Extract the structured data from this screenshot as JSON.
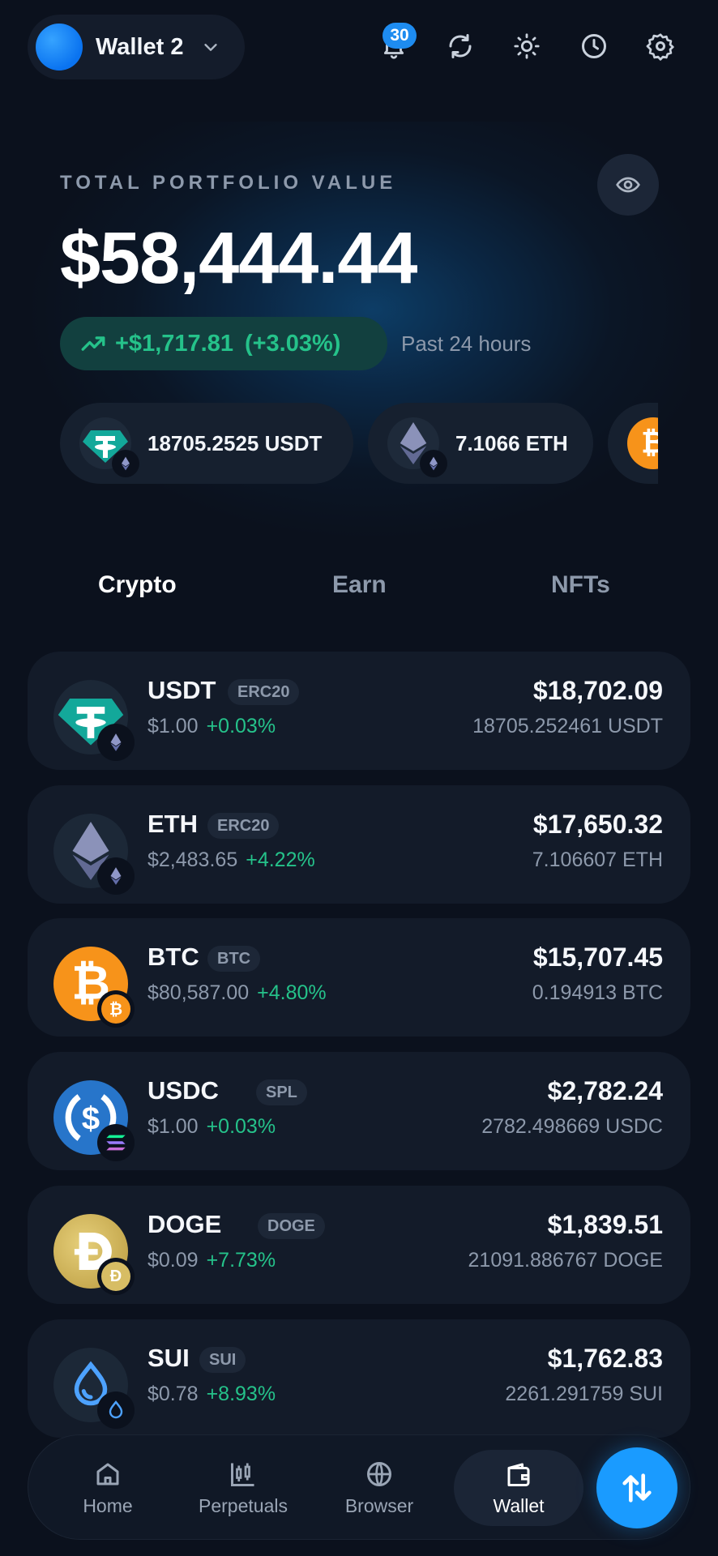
{
  "header": {
    "wallet_name": "Wallet 2",
    "notification_count": "30",
    "icons": [
      "bell-icon",
      "refresh-icon",
      "sun-icon",
      "history-icon",
      "gear-icon"
    ]
  },
  "portfolio": {
    "label": "TOTAL PORTFOLIO VALUE",
    "value": "$58,444.44",
    "change_amount": "+$1,717.81",
    "change_percent": "(+3.03%)",
    "period": "Past 24 hours"
  },
  "chips": [
    {
      "text": "18705.2525 USDT",
      "icon": "tether-icon"
    },
    {
      "text": "7.1066 ETH",
      "icon": "ethereum-icon"
    },
    {
      "text": "",
      "icon": "bitcoin-icon"
    }
  ],
  "tabs": [
    {
      "label": "Crypto",
      "active": true
    },
    {
      "label": "Earn",
      "active": false
    },
    {
      "label": "NFTs",
      "active": false
    }
  ],
  "assets": [
    {
      "symbol": "USDT",
      "network": "ERC20",
      "price": "$1.00",
      "change": "+0.03%",
      "usd_value": "$18,702.09",
      "amount": "18705.252461 USDT"
    },
    {
      "symbol": "ETH",
      "network": "ERC20",
      "price": "$2,483.65",
      "change": "+4.22%",
      "usd_value": "$17,650.32",
      "amount": "7.106607 ETH"
    },
    {
      "symbol": "BTC",
      "network": "BTC",
      "price": "$80,587.00",
      "change": "+4.80%",
      "usd_value": "$15,707.45",
      "amount": "0.194913 BTC"
    },
    {
      "symbol": "USDC",
      "network": "SPL",
      "price": "$1.00",
      "change": "+0.03%",
      "usd_value": "$2,782.24",
      "amount": "2782.498669 USDC"
    },
    {
      "symbol": "DOGE",
      "network": "DOGE",
      "price": "$0.09",
      "change": "+7.73%",
      "usd_value": "$1,839.51",
      "amount": "21091.886767 DOGE"
    },
    {
      "symbol": "SUI",
      "network": "SUI",
      "price": "$0.78",
      "change": "+8.93%",
      "usd_value": "$1,762.83",
      "amount": "2261.291759 SUI"
    }
  ],
  "nav": [
    {
      "label": "Home",
      "icon": "home-icon"
    },
    {
      "label": "Perpetuals",
      "icon": "candlestick-icon"
    },
    {
      "label": "Browser",
      "icon": "globe-icon"
    },
    {
      "label": "Wallet",
      "icon": "wallet-icon",
      "active": true
    }
  ],
  "colors": {
    "background": "#0b111d",
    "card": "#131b29",
    "accent": "#1a9bff",
    "positive": "#25c28a",
    "muted": "#8d99ab"
  }
}
